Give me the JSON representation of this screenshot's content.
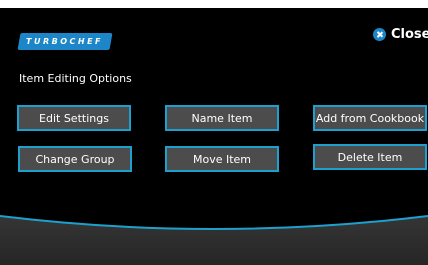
{
  "logo": {
    "text": "TURBOCHEF"
  },
  "header": {
    "close_label": "Close"
  },
  "main": {
    "title": "Item Editing Options",
    "buttons": [
      {
        "label": "Edit Settings"
      },
      {
        "label": "Name Item"
      },
      {
        "label": "Add from Cookbook"
      },
      {
        "label": "Change Group"
      },
      {
        "label": "Move Item"
      },
      {
        "label": "Delete Item"
      }
    ]
  },
  "colors": {
    "background": "#000000",
    "accent": "#1ea0cf",
    "button_fill": "#4c4c4c",
    "footer": "#2b2b2b"
  }
}
